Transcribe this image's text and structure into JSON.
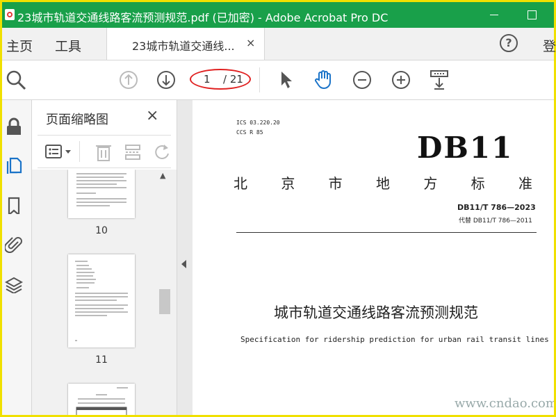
{
  "window": {
    "title": "23城市轨道交通线路客流预测规范.pdf (已加密) - Adobe Acrobat Pro DC"
  },
  "menubar": {
    "home": "主页",
    "tools": "工具",
    "tab_label": "23城市轨道交通线...",
    "tab_close": "×",
    "help": "?",
    "login": "登"
  },
  "toolbar": {
    "page_current": "1",
    "page_total": "/ 21"
  },
  "panel": {
    "title": "页面缩略图",
    "close": "×",
    "thumbnails": [
      {
        "label": "10"
      },
      {
        "label": "11"
      }
    ]
  },
  "document": {
    "ics": "ICS  03.220.20",
    "ccs": "CCS  R 85",
    "db": "DB11",
    "standard_chars": [
      "北",
      "京",
      "市",
      "地",
      "方",
      "标",
      "准"
    ],
    "code": "DB11/T 786—2023",
    "replace": "代替 DB11/T 786—2011",
    "title": "城市轨道交通线路客流预测规范",
    "title_en": "Specification for ridership prediction for urban rail transit lines"
  },
  "watermark": "www.cndao.com",
  "colors": {
    "titlebar": "#19a04a",
    "frame": "#f0e000",
    "page_highlight": "#e02020",
    "active_icon": "#1a73c8"
  }
}
